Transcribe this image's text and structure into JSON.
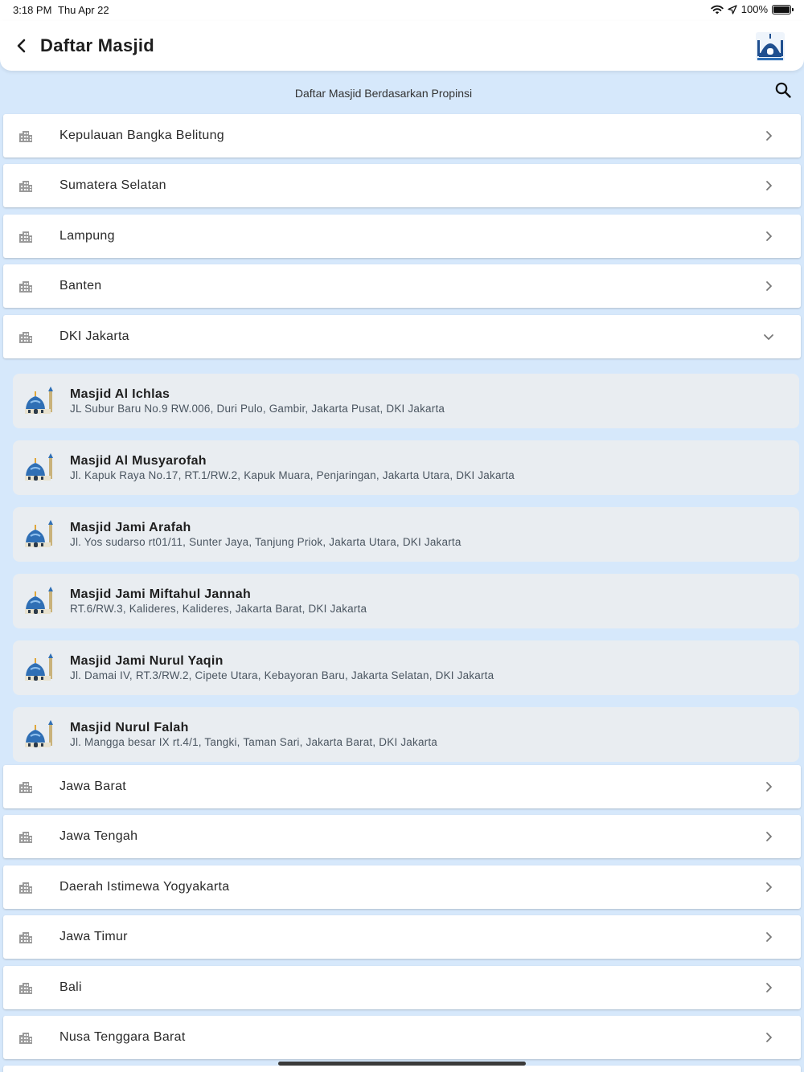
{
  "status_bar": {
    "time": "3:18 PM",
    "date": "Thu Apr 22",
    "battery": "100%",
    "icons": [
      "wifi-icon",
      "location-arrow-icon",
      "battery-icon"
    ]
  },
  "header": {
    "title": "Daftar Masjid",
    "back_icon": "chevron-left-icon",
    "logo": "mosque-logo"
  },
  "subtitle": "Daftar Masjid Berdasarkan Propinsi",
  "search_icon": "search-icon",
  "provinces_before": [
    {
      "name": "Kepulauan Bangka Belitung"
    },
    {
      "name": "Sumatera Selatan"
    },
    {
      "name": "Lampung"
    },
    {
      "name": "Banten"
    }
  ],
  "expanded_province": {
    "name": "DKI Jakarta",
    "mosques": [
      {
        "name": "Masjid Al Ichlas",
        "address": "JL Subur Baru No.9 RW.006, Duri Pulo, Gambir, Jakarta Pusat, DKI Jakarta"
      },
      {
        "name": "Masjid Al Musyarofah",
        "address": "Jl. Kapuk Raya No.17, RT.1/RW.2, Kapuk Muara, Penjaringan, Jakarta Utara, DKI Jakarta"
      },
      {
        "name": "Masjid Jami Arafah",
        "address": "Jl. Yos sudarso rt01/11, Sunter Jaya, Tanjung Priok, Jakarta Utara, DKI Jakarta"
      },
      {
        "name": "Masjid Jami Miftahul Jannah",
        "address": "RT.6/RW.3, Kalideres, Kalideres, Jakarta Barat, DKI Jakarta"
      },
      {
        "name": "Masjid Jami Nurul Yaqin",
        "address": "Jl. Damai IV, RT.3/RW.2, Cipete Utara, Kebayoran Baru, Jakarta Selatan, DKI Jakarta"
      },
      {
        "name": "Masjid Nurul Falah",
        "address": "Jl. Mangga besar IX rt.4/1, Tangki, Taman Sari, Jakarta Barat, DKI Jakarta"
      }
    ]
  },
  "provinces_after": [
    {
      "name": "Jawa Barat"
    },
    {
      "name": "Jawa Tengah"
    },
    {
      "name": "Daerah Istimewa Yogyakarta"
    },
    {
      "name": "Jawa Timur"
    },
    {
      "name": "Bali"
    },
    {
      "name": "Nusa Tenggara Barat"
    }
  ],
  "colors": {
    "background": "#d6e8fb",
    "row": "#ffffff",
    "mosque_card": "#e9edf1",
    "mosque_dome": "#2f6fb5"
  }
}
